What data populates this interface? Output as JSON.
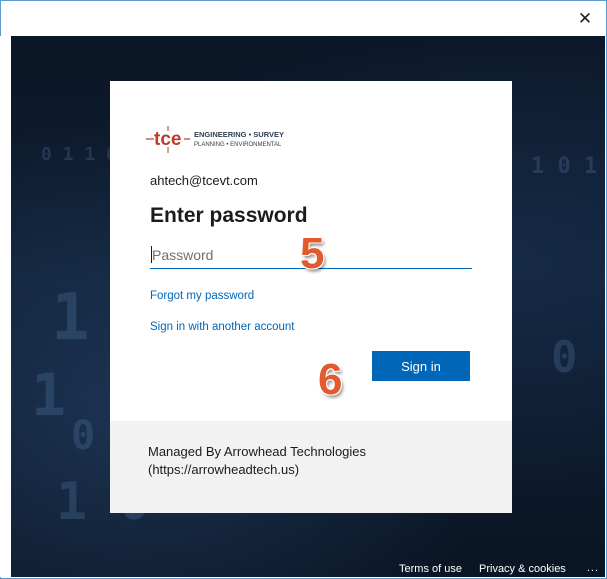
{
  "titlebar": {
    "close_glyph": "✕"
  },
  "logo": {
    "mark": "tce",
    "line1": "ENGINEERING • SURVEY",
    "line2": "PLANNING • ENVIRONMENTAL",
    "color_mark": "#c0392b",
    "color_text": "#2c3e50"
  },
  "card": {
    "email": "ahtech@tcevt.com",
    "title": "Enter password",
    "password_placeholder": "Password",
    "forgot_label": "Forgot my password",
    "another_account_label": "Sign in with another account",
    "signin_label": "Sign in",
    "managed_line1": "Managed By Arrowhead Technologies",
    "managed_line2": "(https://arrowheadtech.us)"
  },
  "annotations": {
    "step5": "5",
    "step6": "6",
    "color": "#e35a2e"
  },
  "footer": {
    "terms_label": "Terms of use",
    "privacy_label": "Privacy & cookies",
    "more_label": "..."
  },
  "colors": {
    "accent": "#0067b8",
    "backdrop": "#0f2035"
  }
}
